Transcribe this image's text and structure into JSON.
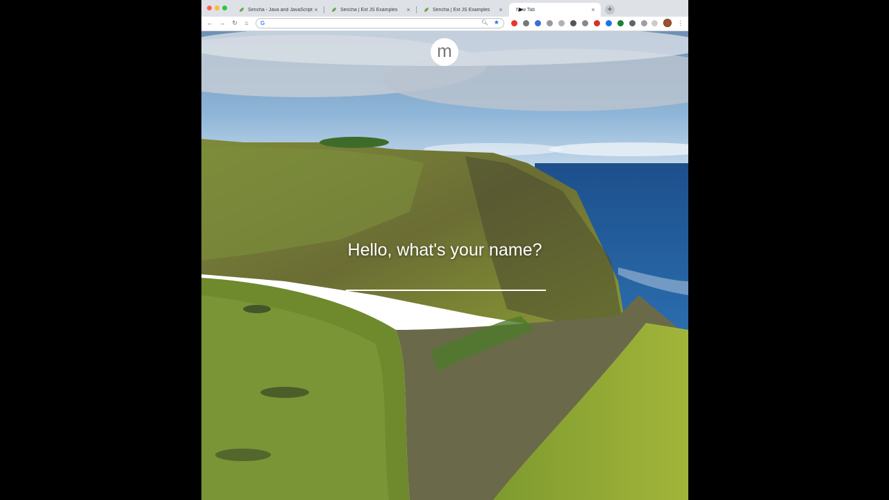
{
  "browser": {
    "tabs": [
      {
        "title": "Sencha - Java and JavaScript F",
        "active": false,
        "favicon": "sencha-leaf-icon"
      },
      {
        "title": "Sencha | Ext JS Examples",
        "active": false,
        "favicon": "sencha-leaf-icon"
      },
      {
        "title": "Sencha | Ext JS Examples",
        "active": false,
        "favicon": "sencha-leaf-icon"
      },
      {
        "title": "New Tab",
        "active": true,
        "favicon": "none"
      }
    ],
    "omnibox": {
      "value": "",
      "placeholder": ""
    },
    "colors": {
      "tabstrip": "#dee1e6",
      "accent": "#1a73e8"
    }
  },
  "page": {
    "logo_letter": "m",
    "greeting": "Hello, what's your name?",
    "name_input": {
      "value": "",
      "placeholder": ""
    }
  }
}
